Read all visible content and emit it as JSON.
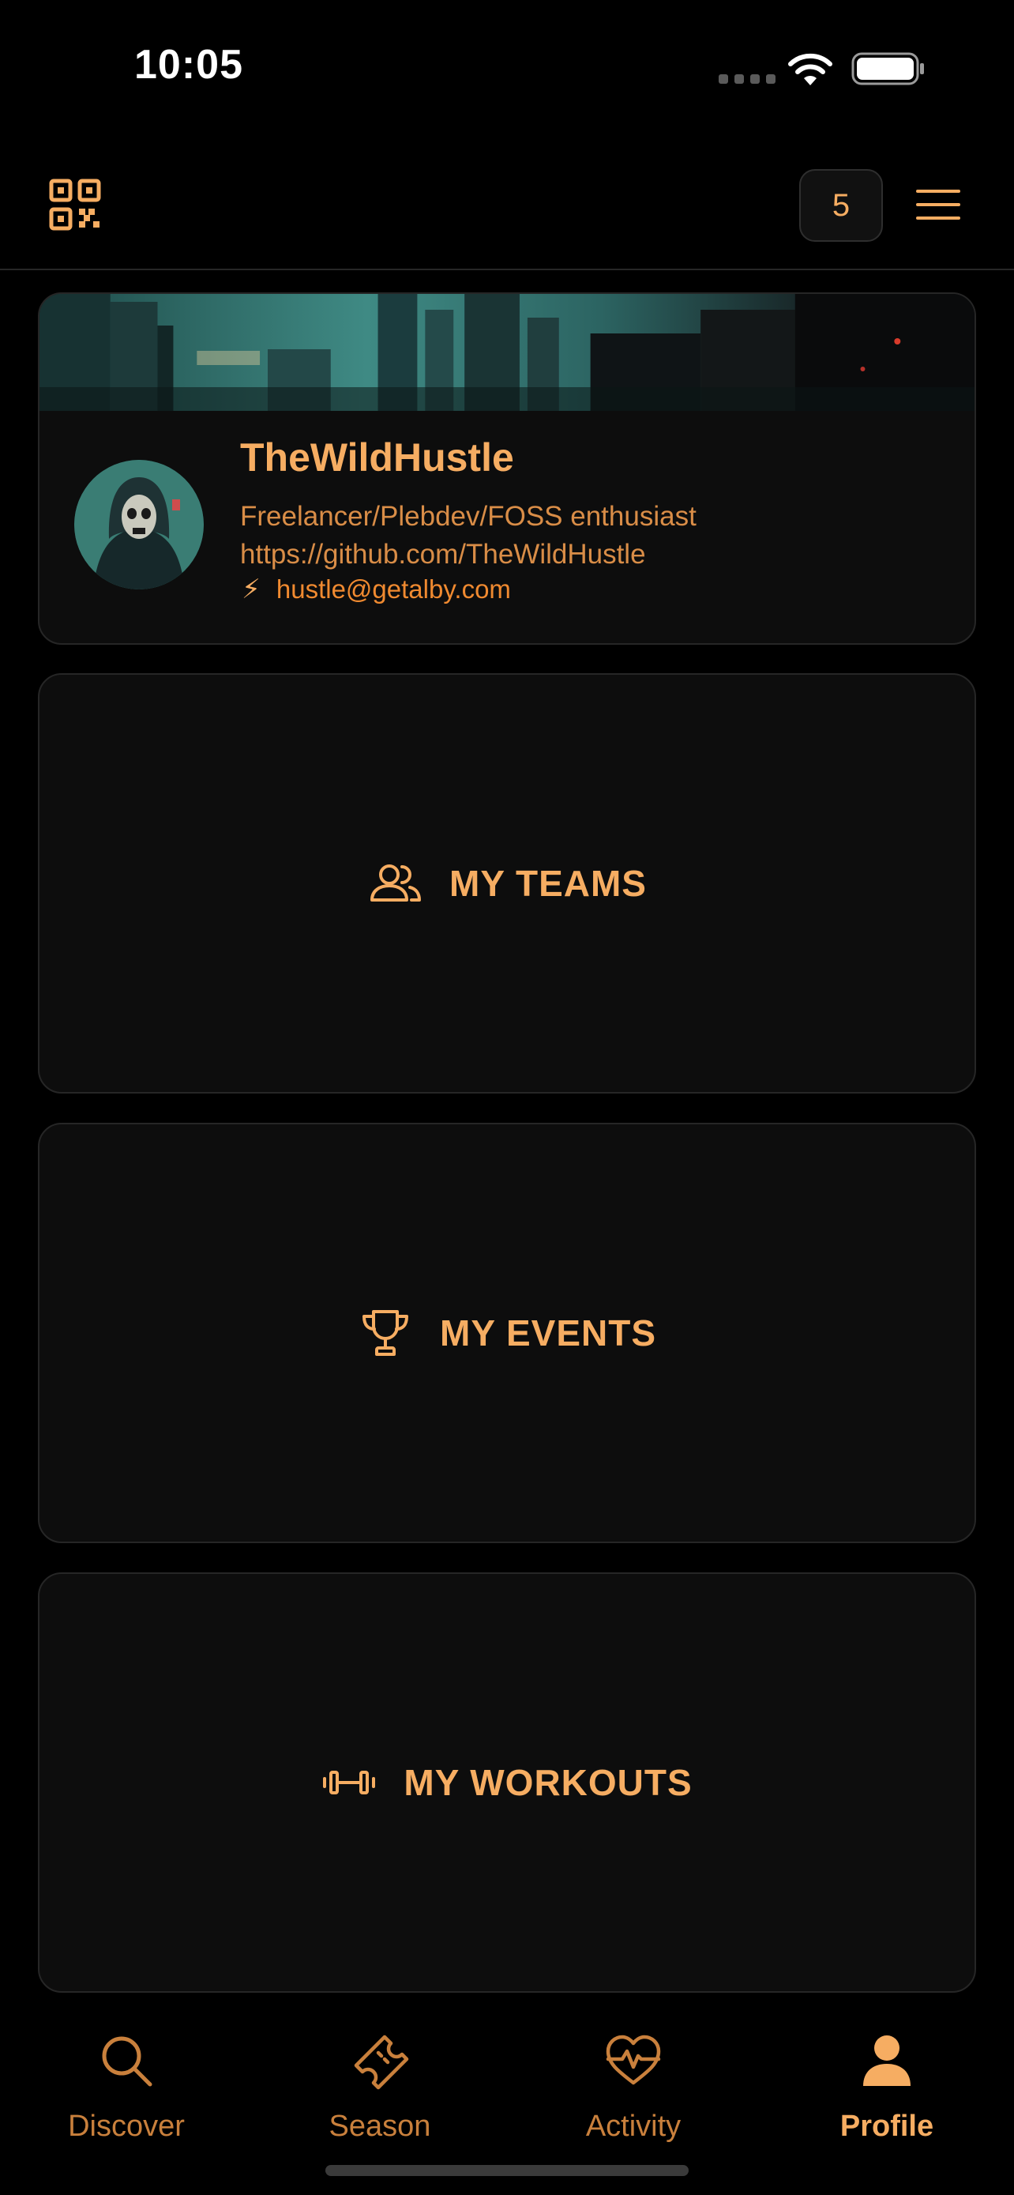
{
  "status_bar": {
    "time": "10:05"
  },
  "topnav": {
    "notifications_count": "5"
  },
  "profile": {
    "name": "TheWildHustle",
    "bio_line1": "Freelancer/Plebdev/FOSS enthusiast",
    "bio_line2": "https://github.com/TheWildHustle",
    "bolt": "⚡",
    "lightning_address": "hustle@getalby.com"
  },
  "sections": {
    "teams": "MY TEAMS",
    "events": "MY EVENTS",
    "workouts": "MY WORKOUTS"
  },
  "tabs": {
    "discover": "Discover",
    "season": "Season",
    "activity": "Activity",
    "profile": "Profile"
  },
  "colors": {
    "accent": "#f6ad62",
    "accent_dim": "#c9803c",
    "card_bg": "#0d0d0d",
    "border": "#262626"
  }
}
